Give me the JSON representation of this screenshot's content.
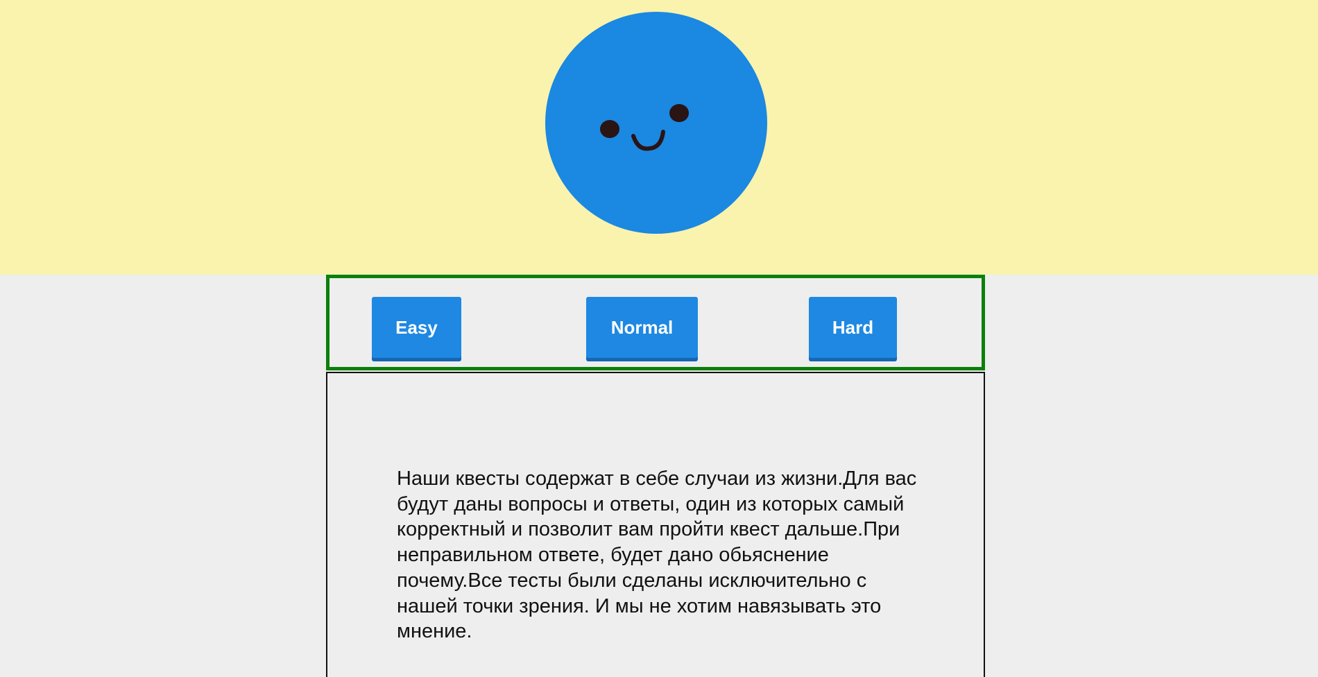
{
  "mascot": {
    "icon": "smiley-face-icon",
    "face_color": "#1b88e1",
    "feature_color": "#2a1414"
  },
  "difficulty": {
    "easy_label": "Easy",
    "normal_label": "Normal",
    "hard_label": "Hard",
    "button_color": "#1e88e2",
    "panel_border_color": "#0b800b"
  },
  "info": {
    "text": "Наши квесты содержат в себе случаи из жизни.Для вас будут даны вопросы и ответы, один из которых самый корректный и позволит вам пройти квест дальше.При неправильном ответе, будет дано обьяснение почему.Все тесты были сделаны исключительно с нашей точки зрения. И мы не хотим навязывать это мнение."
  },
  "colors": {
    "hero_background": "#f9f3ad",
    "page_background": "#eeeeee"
  }
}
